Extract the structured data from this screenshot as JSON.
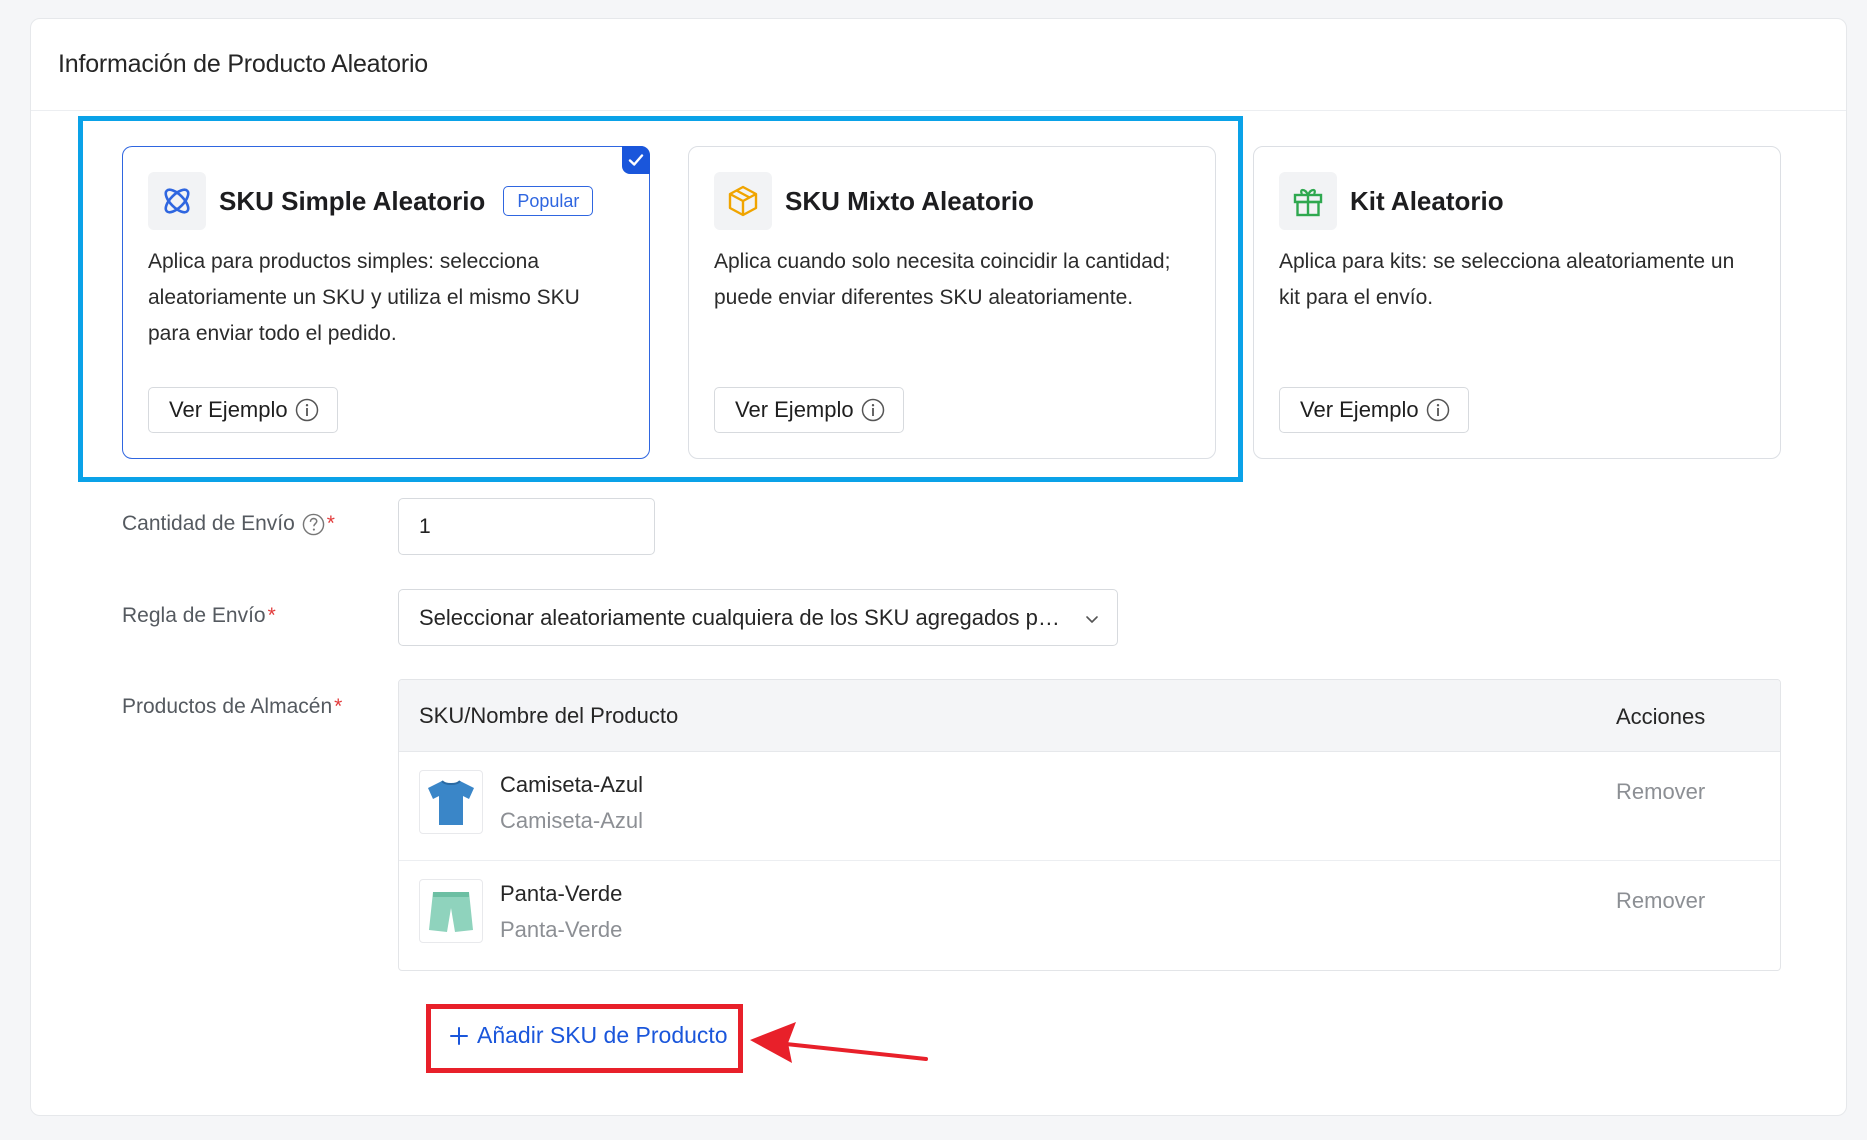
{
  "panel": {
    "title": "Información de Producto Aleatorio"
  },
  "cards": [
    {
      "title": "SKU Simple Aleatorio",
      "badge": "Popular",
      "desc": "Aplica para productos simples: selecciona aleatoriamente un SKU y utiliza el mismo SKU para enviar todo el pedido.",
      "button": "Ver Ejemplo",
      "selected": true,
      "icon": "atom-icon"
    },
    {
      "title": "SKU Mixto Aleatorio",
      "desc": "Aplica cuando solo necesita coincidir la cantidad; puede enviar diferentes SKU aleatoriamente.",
      "button": "Ver Ejemplo",
      "icon": "box-icon"
    },
    {
      "title": "Kit Aleatorio",
      "desc": "Aplica para kits: se selecciona aleatoriamente un kit para el envío.",
      "button": "Ver Ejemplo",
      "icon": "gift-icon"
    }
  ],
  "form": {
    "qty_label": "Cantidad de Envío",
    "qty_value": "1",
    "rule_label": "Regla de Envío",
    "rule_value": "Seleccionar aleatoriamente cualquiera de los SKU agregados para el envío",
    "products_label": "Productos de Almacén",
    "required_mark": "*"
  },
  "table": {
    "col_name": "SKU/Nombre del Producto",
    "col_actions": "Acciones",
    "rows": [
      {
        "name": "Camiseta-Azul",
        "sku": "Camiseta-Azul",
        "action": "Remover",
        "thumb": "tshirt-icon"
      },
      {
        "name": "Panta-Verde",
        "sku": "Panta-Verde",
        "action": "Remover",
        "thumb": "shorts-icon"
      }
    ]
  },
  "add_button": "Añadir SKU de Producto",
  "colors": {
    "primary": "#1a56db",
    "highlight_blue": "#0aa2e8",
    "annotation_red": "#e8202a",
    "required": "#e23b3b",
    "box_icon": "#f0a400",
    "gift_icon": "#2fa84f"
  }
}
